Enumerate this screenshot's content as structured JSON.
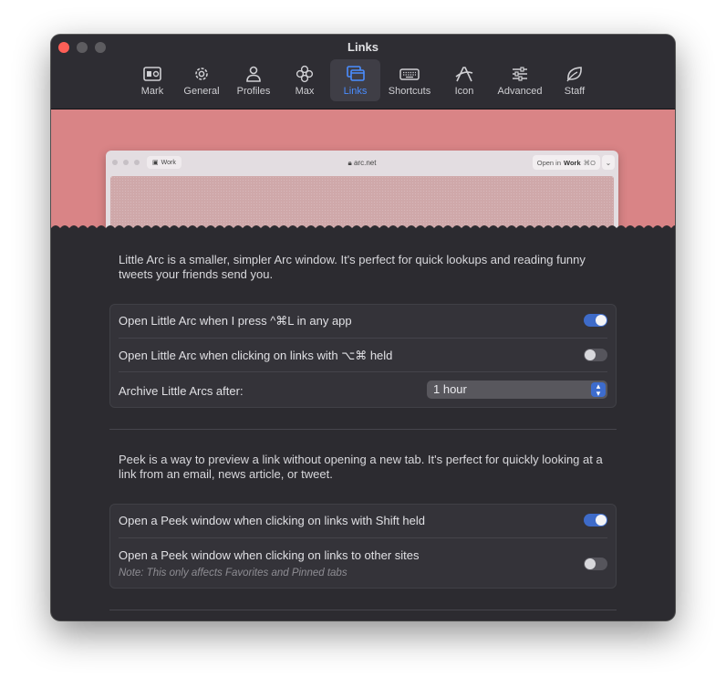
{
  "window": {
    "title": "Links"
  },
  "toolbar": {
    "items": [
      {
        "label": "Mark",
        "icon": "mark-icon"
      },
      {
        "label": "General",
        "icon": "gear-icon"
      },
      {
        "label": "Profiles",
        "icon": "person-icon"
      },
      {
        "label": "Max",
        "icon": "flower-icon"
      },
      {
        "label": "Links",
        "icon": "windows-icon",
        "active": true
      },
      {
        "label": "Shortcuts",
        "icon": "keyboard-icon"
      },
      {
        "label": "Icon",
        "icon": "arc-logo-icon"
      },
      {
        "label": "Advanced",
        "icon": "sliders-icon"
      },
      {
        "label": "Staff",
        "icon": "leaf-icon"
      }
    ]
  },
  "preview": {
    "tab_label": "Work",
    "url": "arc.net",
    "open_in_prefix": "Open in",
    "open_in_space": "Work",
    "open_in_shortcut": "⌘O"
  },
  "little_arc": {
    "description": "Little Arc is a smaller, simpler Arc window. It's perfect for quick lookups and reading funny tweets your friends send you.",
    "settings": [
      {
        "label": "Open Little Arc when I press ^⌘L in any app",
        "enabled": true
      },
      {
        "label": "Open Little Arc when clicking on links with ⌥⌘ held",
        "enabled": false
      }
    ],
    "archive": {
      "label": "Archive Little Arcs after:",
      "value": "1 hour"
    }
  },
  "peek": {
    "description": "Peek is a way to preview a link without opening a new tab. It's perfect for quickly looking at a link from an email, news article, or tweet.",
    "settings": [
      {
        "label": "Open a Peek window when clicking on links with Shift held",
        "enabled": true
      },
      {
        "label": "Open a Peek window when clicking on links to other sites",
        "note": "Note: This only affects Favorites and Pinned tabs",
        "enabled": false
      }
    ]
  },
  "colors": {
    "accent": "#4a8dff",
    "toggle_on": "#3e6bc9",
    "hero_background": "#d98486",
    "window_background": "#2c2b30"
  }
}
